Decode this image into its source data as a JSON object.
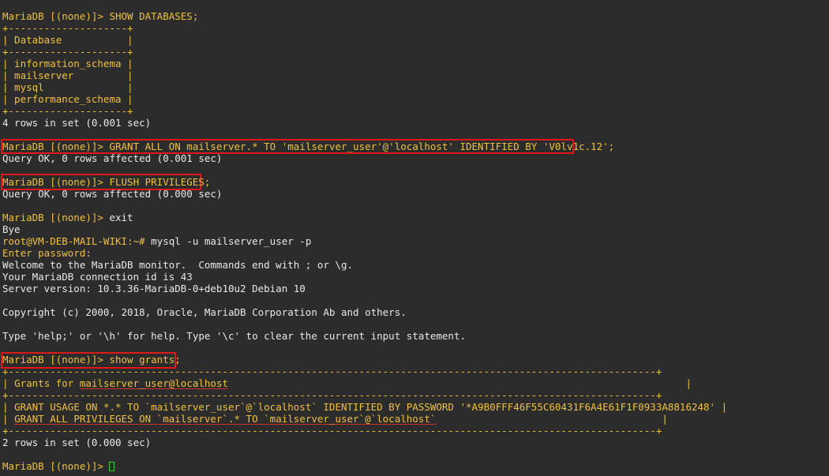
{
  "terminal": {
    "show_db": {
      "prompt": "MariaDB [(none)]> ",
      "cmd": "SHOW DATABASES;",
      "border": "+--------------------+",
      "header": "| Database           |",
      "rows": [
        "| information_schema |",
        "| mailserver         |",
        "| mysql              |",
        "| performance_schema |"
      ],
      "result": "4 rows in set (0.001 sec)"
    },
    "grant": {
      "prompt": "MariaDB [(none)]> ",
      "cmd": "GRANT ALL ON mailserver.* TO 'mailserver_user'@'localhost' IDENTIFIED BY 'V0lv1c.12';",
      "result": "Query OK, 0 rows affected (0.001 sec)"
    },
    "flush": {
      "prompt": "MariaDB [(none)]> ",
      "cmd": "FLUSH PRIVILEGES;",
      "result": "Query OK, 0 rows affected (0.000 sec)"
    },
    "exit": {
      "prompt": "MariaDB [(none)]> ",
      "cmd": "exit",
      "bye": "Bye"
    },
    "shell": {
      "prompt": "root@VM-DEB-MAIL-WIKI:~# ",
      "cmd": "mysql -u mailserver_user -p",
      "password_prompt": "Enter password:"
    },
    "welcome": {
      "line1": "Welcome to the MariaDB monitor.  Commands end with ; or \\g.",
      "line2": "Your MariaDB connection id is 43",
      "line3": "Server version: 10.3.36-MariaDB-0+deb10u2 Debian 10",
      "copyright": "Copyright (c) 2000, 2018, Oracle, MariaDB Corporation Ab and others.",
      "help": "Type 'help;' or '\\h' for help. Type '\\c' to clear the current input statement."
    },
    "grants": {
      "prompt": "MariaDB [(none)]> ",
      "cmd": "show grants;",
      "border": "+-------------------------------------------------------------------------------------------------------------+",
      "header_prefix": "Grants for ",
      "header_user": "mailserver_user@localhost",
      "rows": [
        "GRANT USAGE ON *.* TO `mailserver_user`@`localhost` IDENTIFIED BY PASSWORD '*A9B0FFF46F55C60431F6A4E61F1F0933A8816248'",
        "GRANT ALL PRIVILEGES ON `mailserver`.* TO `mailserver_user`@`localhost`"
      ],
      "result": "2 rows in set (0.000 sec)"
    },
    "final_prompt": "MariaDB [(none)]> ",
    "colors": {
      "background": "#2c2c2c",
      "prompt": "#f0c040",
      "text": "#e8e8e8",
      "highlight": "#e01818",
      "cursor": "#32d232"
    }
  }
}
